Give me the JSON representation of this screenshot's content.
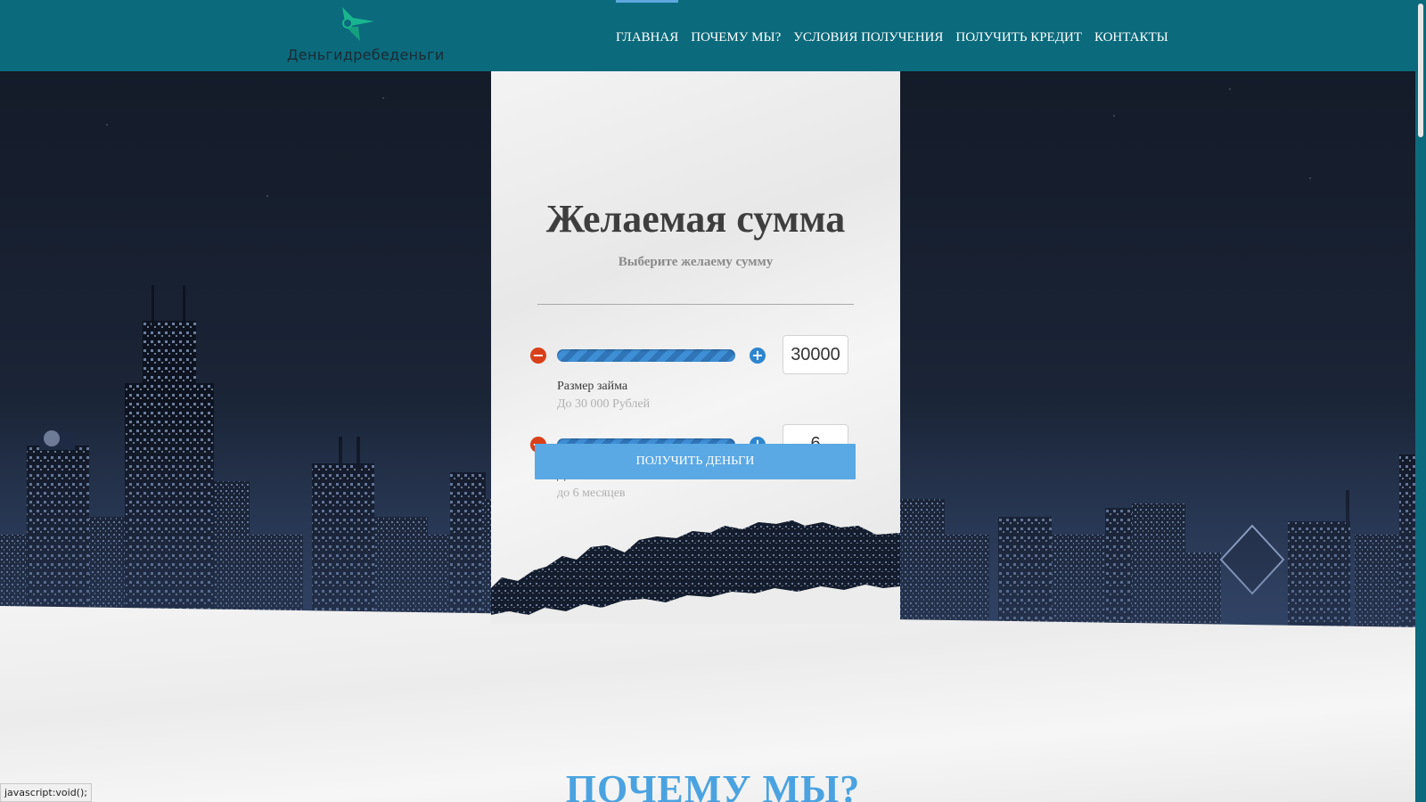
{
  "header": {
    "logo_text": "Деньгидребеденьги",
    "nav": [
      {
        "label": "Главная",
        "active": true
      },
      {
        "label": "Почему мы?",
        "active": false
      },
      {
        "label": "Условия получения",
        "active": false
      },
      {
        "label": "Получить кредит",
        "active": false
      },
      {
        "label": "Контакты",
        "active": false
      }
    ]
  },
  "calculator": {
    "title": "Желаемая сумма",
    "subtitle": "Выберите желаему сумму",
    "amount": {
      "value": "30000",
      "label": "Размер займа",
      "hint": "До 30 000 Рублей"
    },
    "term": {
      "value": "6",
      "label": "Дата погашения",
      "hint": "до 6 месяцев"
    },
    "submit_label": "Получить деньги"
  },
  "next_section": {
    "title": "ПОЧЕМУ МЫ?"
  },
  "status_bar": {
    "text": "javascript:void();"
  },
  "colors": {
    "header_bg": "#0b6a7c",
    "accent_blue": "#5aa9e4",
    "minus_button": "#d9401a",
    "plus_button": "#2e86cf",
    "section_title": "#4aa3e0"
  },
  "icons": {
    "logo": "arrow-leaf-logo-icon",
    "decrement": "minus-circle-icon",
    "increment": "plus-circle-icon"
  }
}
